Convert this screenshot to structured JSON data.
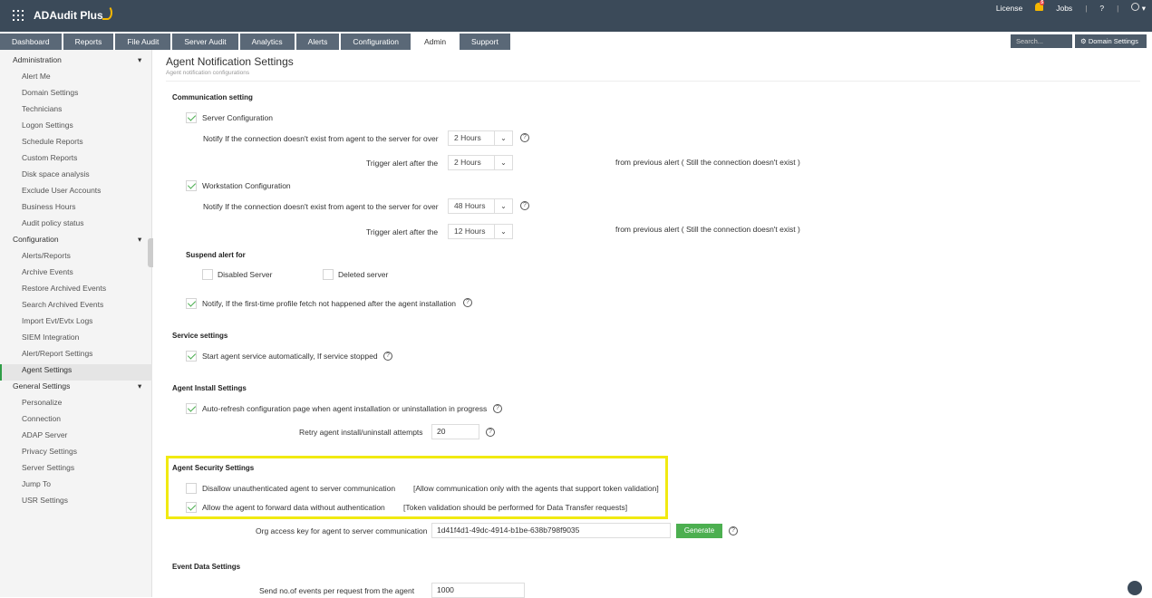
{
  "app": {
    "name": "ADAudit Plus"
  },
  "top_links": {
    "license": "License",
    "notif_count": "5",
    "jobs": "Jobs",
    "help": "?"
  },
  "tabs": [
    "Dashboard",
    "Reports",
    "File Audit",
    "Server Audit",
    "Analytics",
    "Alerts",
    "Configuration",
    "Admin",
    "Support"
  ],
  "active_tab": "Admin",
  "search": {
    "placeholder": "Search..."
  },
  "domain_settings": "Domain Settings",
  "sidebar": {
    "sections": [
      {
        "title": "Administration",
        "items": [
          "Alert Me",
          "Domain Settings",
          "Technicians",
          "Logon Settings",
          "Schedule Reports",
          "Custom Reports",
          "Disk space analysis",
          "Exclude User Accounts",
          "Business Hours",
          "Audit policy status"
        ]
      },
      {
        "title": "Configuration",
        "items": [
          "Alerts/Reports",
          "Archive Events",
          "Restore Archived Events",
          "Search Archived Events",
          "Import Evt/Evtx Logs",
          "SIEM Integration",
          "Alert/Report Settings",
          "Agent Settings"
        ]
      },
      {
        "title": "General Settings",
        "items": [
          "Personalize",
          "Connection",
          "ADAP Server",
          "Privacy Settings",
          "Server Settings",
          "Jump To",
          "USR Settings"
        ]
      }
    ],
    "active_item": "Agent Settings"
  },
  "page": {
    "title": "Agent Notification Settings",
    "subtitle": "Agent notification configurations"
  },
  "comm": {
    "title": "Communication setting",
    "server_cfg": "Server Configuration",
    "notify_label": "Notify If the connection doesn't exist from agent to the server for over",
    "trigger_label": "Trigger alert after the",
    "from_prev": "from previous alert ( Still the connection doesn't exist )",
    "server_notify": "2 Hours",
    "server_trigger": "2 Hours",
    "ws_cfg": "Workstation Configuration",
    "ws_notify": "48 Hours",
    "ws_trigger": "12 Hours",
    "suspend_title": "Suspend alert for",
    "disabled_server": "Disabled Server",
    "deleted_server": "Deleted server",
    "first_time": "Notify, If the first-time profile fetch not happened after the agent installation"
  },
  "service": {
    "title": "Service settings",
    "start_auto": "Start agent service automatically, If service stopped"
  },
  "install": {
    "title": "Agent Install Settings",
    "auto_refresh": "Auto-refresh configuration page when agent installation or uninstallation in progress",
    "retry_label": "Retry agent install/uninstall attempts",
    "retry_value": "20"
  },
  "security": {
    "title": "Agent Security Settings",
    "disallow": "Disallow unauthenticated agent to server communication",
    "disallow_note": "[Allow communication only with the agents that support token validation]",
    "allow": "Allow the agent to forward data without authentication",
    "allow_note": "[Token validation should be performed for Data Transfer requests]",
    "org_key_label": "Org access key for agent to server communication",
    "org_key": "1d41f4d1-49dc-4914-b1be-638b798f9035",
    "generate": "Generate"
  },
  "event": {
    "title": "Event Data Settings",
    "send_label": "Send no.of events per request from the agent",
    "send_value": "1000"
  }
}
